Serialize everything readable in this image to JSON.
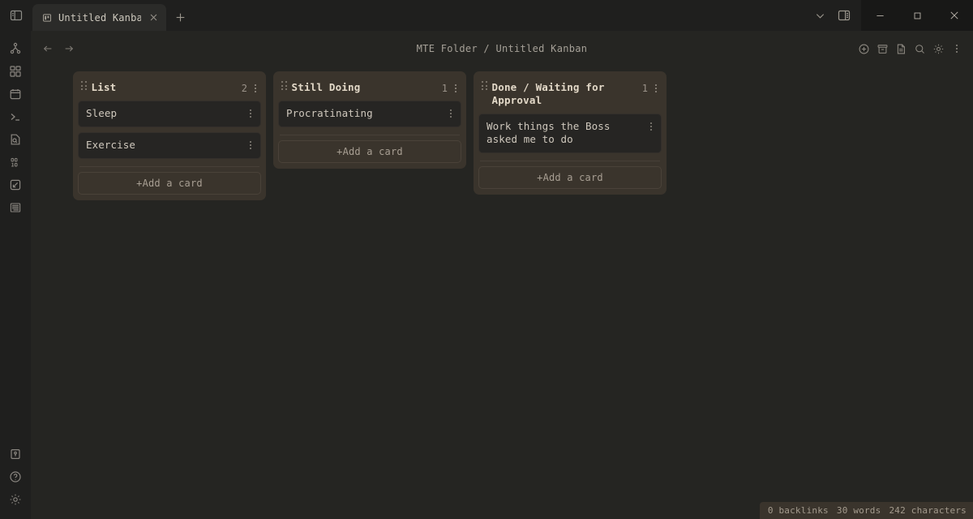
{
  "window": {
    "sidebar_toggle_icon": "sidebar-panel-icon",
    "chevron_icon": "chevron-down-icon",
    "right_panel_icon": "right-panel-icon",
    "minimize_label": "–",
    "maximize_label": "□",
    "close_label": "✕"
  },
  "tabs": [
    {
      "title": "Untitled Kanban",
      "icon": "kanban-tab-icon",
      "close_icon": "close-icon",
      "active": true
    }
  ],
  "new_tab": {
    "label": "+",
    "icon": "plus-icon"
  },
  "ribbon": {
    "items": [
      {
        "name": "git-graph-icon"
      },
      {
        "name": "grid-blocks-icon"
      },
      {
        "name": "calendar-icon"
      },
      {
        "name": "terminal-icon"
      },
      {
        "name": "file-search-icon"
      },
      {
        "name": "binary-icon",
        "glyph": "01\n10"
      },
      {
        "name": "excalidraw-icon"
      },
      {
        "name": "text-lines-icon"
      }
    ],
    "bottom_items": [
      {
        "name": "pin-box-icon"
      },
      {
        "name": "help-circle-icon"
      },
      {
        "name": "settings-gear-icon"
      }
    ]
  },
  "viewheader": {
    "back_icon": "arrow-left-icon",
    "forward_icon": "arrow-right-icon",
    "breadcrumb": "MTE Folder / Untitled Kanban",
    "actions": [
      {
        "name": "add-circle-icon"
      },
      {
        "name": "archive-box-icon"
      },
      {
        "name": "document-icon"
      },
      {
        "name": "search-icon"
      },
      {
        "name": "gear-icon"
      },
      {
        "name": "more-vertical-icon"
      }
    ]
  },
  "board": {
    "add_card_label": "+Add a card",
    "columns": [
      {
        "title": "List",
        "count": "2",
        "cards": [
          {
            "text": "Sleep"
          },
          {
            "text": "Exercise"
          }
        ]
      },
      {
        "title": "Still Doing",
        "count": "1",
        "cards": [
          {
            "text": "Procratinating"
          }
        ]
      },
      {
        "title": "Done / Waiting for Approval",
        "count": "1",
        "cards": [
          {
            "text": "Work things the Boss asked me to do"
          }
        ]
      }
    ]
  },
  "statusbar": {
    "backlinks": "0 backlinks",
    "words": "30 words",
    "characters": "242 characters"
  },
  "colors": {
    "app_background": "#252522",
    "titlebar": "#1f1f1e",
    "column": "#3a342c",
    "card": "#262523",
    "accent_text": "#e3d9c8"
  }
}
